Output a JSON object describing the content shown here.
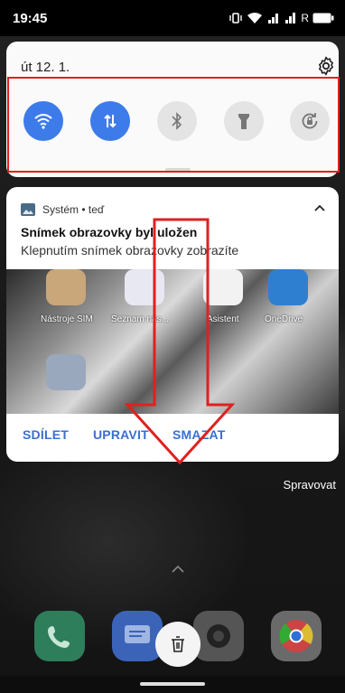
{
  "status_bar": {
    "time": "19:45",
    "icons": [
      "vibrate-icon",
      "wifi-icon",
      "signal-4g-icon",
      "signal-icon",
      "r-roaming-icon",
      "battery-icon"
    ],
    "roaming_label": "R"
  },
  "quick_settings": {
    "date": "út 12. 1.",
    "tiles": [
      {
        "name": "wifi",
        "state": "on"
      },
      {
        "name": "mobile-data",
        "state": "on"
      },
      {
        "name": "bluetooth",
        "state": "off"
      },
      {
        "name": "flashlight",
        "state": "off"
      },
      {
        "name": "auto-rotate",
        "state": "off"
      }
    ]
  },
  "notification": {
    "app": "Systém • teď",
    "title": "Snímek obrazovky byl uložen",
    "text": "Klepnutím snímek obrazovky zobrazíte",
    "preview_labels": [
      "Nástroje SIM",
      "Seznam nás...",
      "Asistent",
      "OneDrive"
    ],
    "actions": [
      "SDÍLET",
      "UPRAVIT",
      "SMAZAT"
    ]
  },
  "manage_label": "Spravovat",
  "colors": {
    "accent": "#3d7bea",
    "action_text": "#3a6fd0",
    "annotation": "#e02020"
  }
}
